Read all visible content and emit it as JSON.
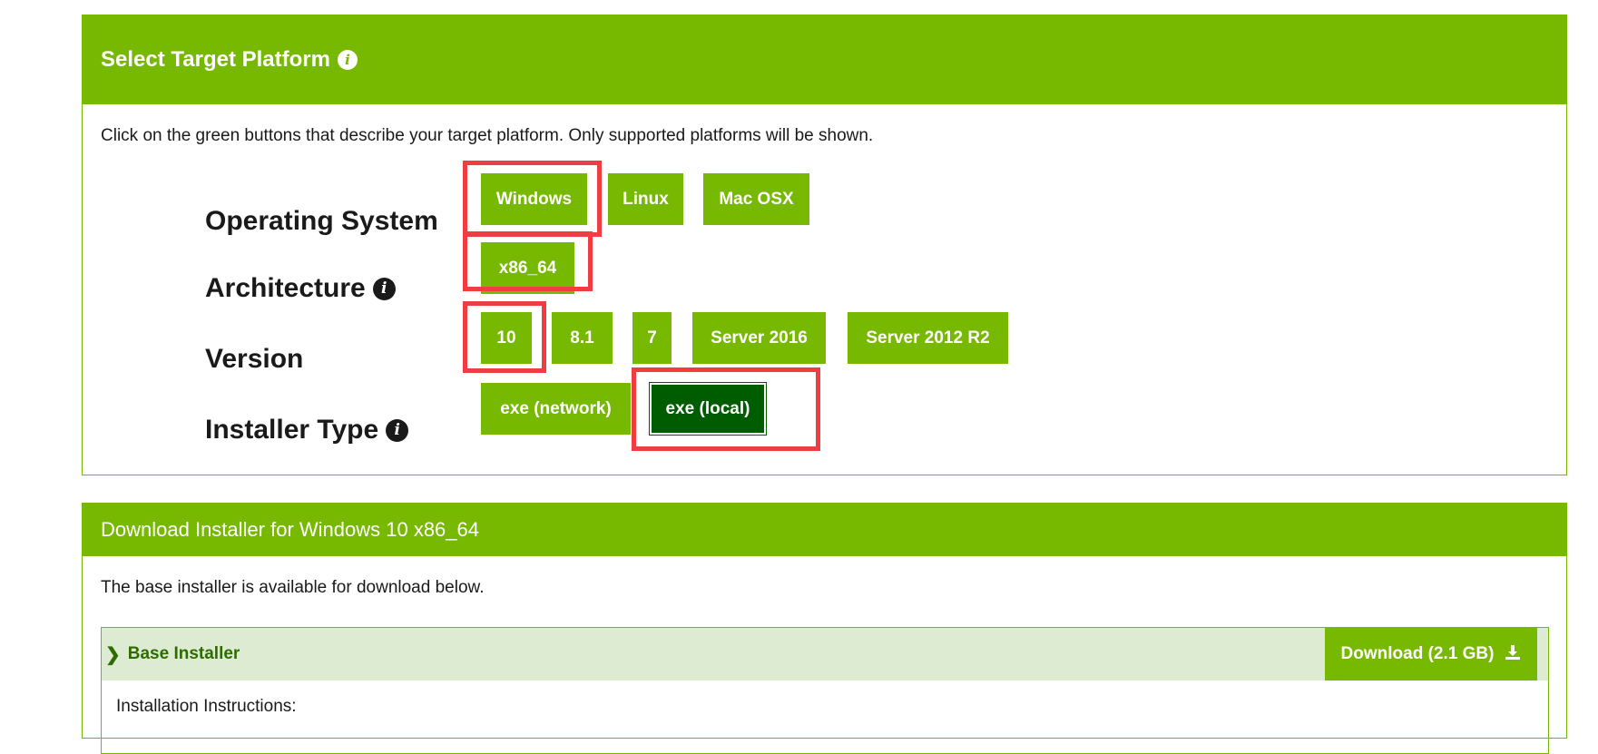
{
  "select_panel": {
    "title": "Select Target Platform",
    "description": "Click on the green buttons that describe your target platform. Only supported platforms will be shown.",
    "rows": {
      "os": {
        "label": "Operating System",
        "options": [
          "Windows",
          "Linux",
          "Mac OSX"
        ]
      },
      "arch": {
        "label": "Architecture",
        "options": [
          "x86_64"
        ]
      },
      "version": {
        "label": "Version",
        "options": [
          "10",
          "8.1",
          "7",
          "Server 2016",
          "Server 2012 R2"
        ]
      },
      "installer": {
        "label": "Installer Type",
        "options": [
          "exe (network)",
          "exe (local)"
        ]
      }
    },
    "selected": {
      "installer": "exe (local)"
    }
  },
  "download_panel": {
    "title": "Download Installer for Windows 10 x86_64",
    "description": "The base installer is available for download below.",
    "base_installer": {
      "label": "Base Installer",
      "download_label": "Download (2.1 GB)",
      "instructions_label": "Installation Instructions:"
    }
  },
  "colors": {
    "brand_green": "#76b900",
    "selected_green": "#005c00",
    "highlight_red": "#ef3e42",
    "accordion_bg": "#dcebd2"
  },
  "icons": [
    "info-icon",
    "chevron-right-icon",
    "download-icon"
  ]
}
